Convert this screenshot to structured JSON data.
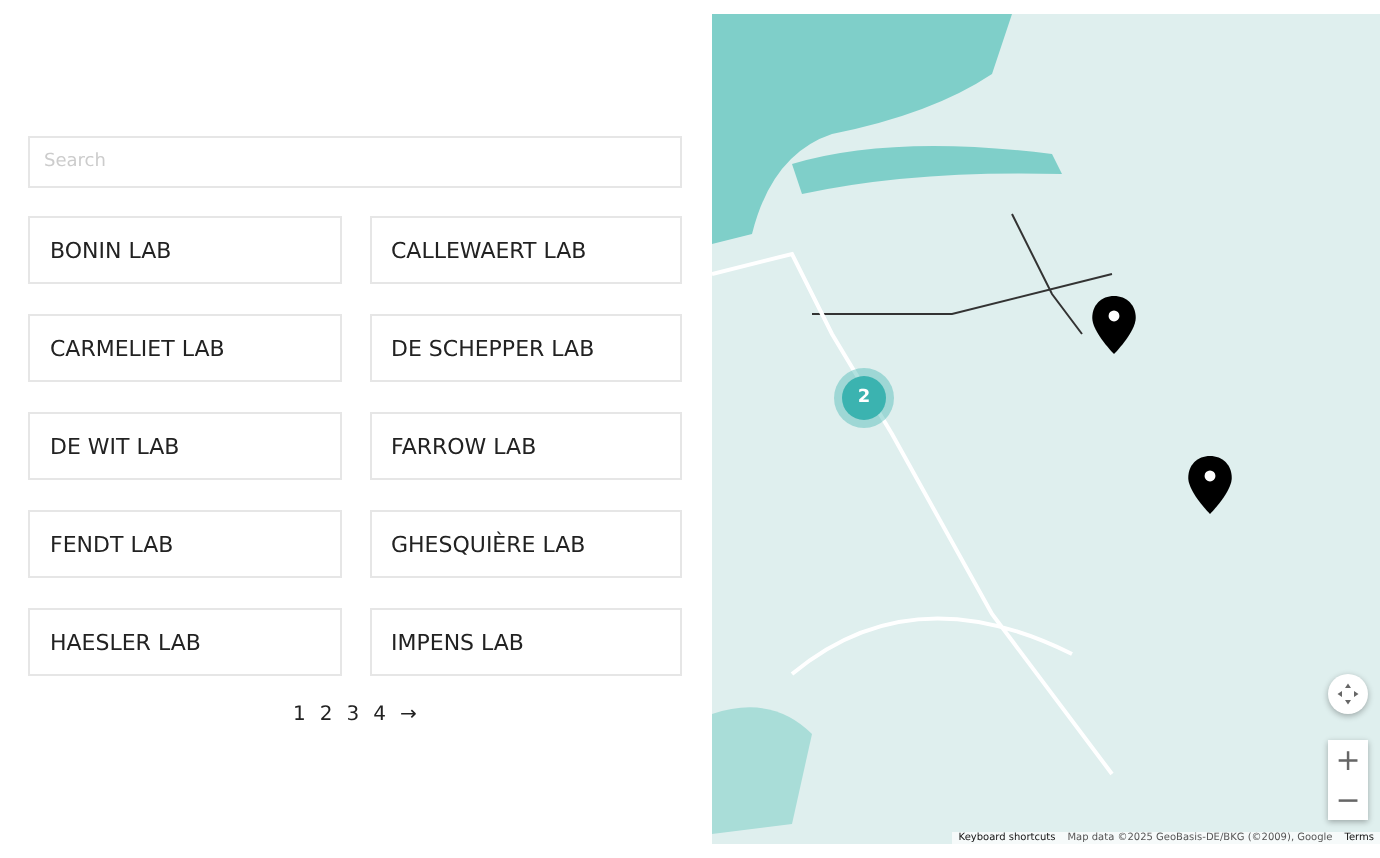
{
  "search": {
    "placeholder": "Search"
  },
  "labs": [
    "BONIN LAB",
    "CALLEWAERT LAB",
    "CARMELIET LAB",
    "DE SCHEPPER LAB",
    "DE WIT LAB",
    "FARROW LAB",
    "FENDT LAB",
    "GHESQUIÈRE LAB",
    "HAESLER LAB",
    "IMPENS LAB"
  ],
  "pagination": {
    "pages": [
      "1",
      "2",
      "3",
      "4"
    ],
    "next": "→"
  },
  "map": {
    "cluster": {
      "count": "2"
    },
    "zoom_in": "+",
    "zoom_out": "−",
    "attribution": [
      {
        "kind": "link",
        "text": "Keyboard shortcuts"
      },
      {
        "kind": "text",
        "text": "Map data ©2025 GeoBasis-DE/BKG (©2009), Google"
      },
      {
        "kind": "link",
        "text": "Terms"
      }
    ]
  }
}
